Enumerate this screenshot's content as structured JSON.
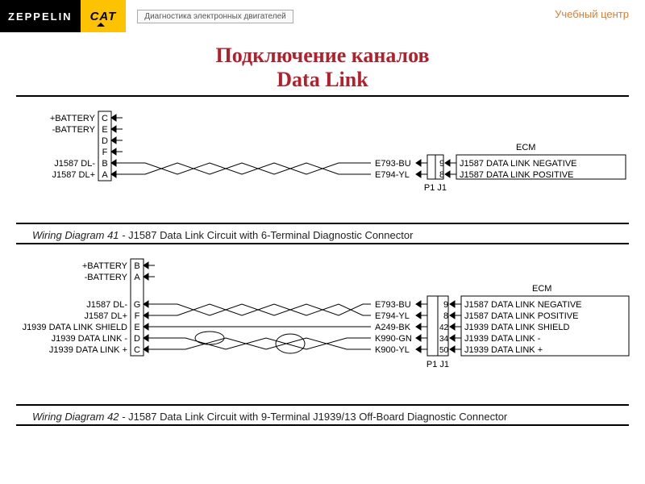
{
  "header": {
    "logo1": "ZEPPELIN",
    "logo2": "CAT",
    "subtitle": "Диагностика электронных двигателей",
    "right": "Учебный центр"
  },
  "title": {
    "line1": "Подключение каналов",
    "line2": "Data Link"
  },
  "d1": {
    "ecm_label": "ECM",
    "caption_prefix": "Wiring Diagram 41 - ",
    "caption": "J1587 Data Link Circuit with 6-Terminal Diagnostic Connector",
    "p1j1": "P1 J1",
    "left": {
      "bat_pos": "+BATTERY",
      "bat_neg": "-BATTERY",
      "j_dlm": "J1587 DL-",
      "j_dlp": "J1587 DL+"
    },
    "pins_left": {
      "c": "C",
      "e": "E",
      "d": "D",
      "f": "F",
      "b": "B",
      "a": "A"
    },
    "wires": {
      "bu": "E793-BU",
      "yl": "E794-YL"
    },
    "pins_right": {
      "p9": "9",
      "p8": "8"
    },
    "ecm": {
      "neg": "J1587 DATA LINK NEGATIVE",
      "pos": "J1587 DATA LINK POSITIVE"
    }
  },
  "d2": {
    "ecm_label": "ECM",
    "caption_prefix": "Wiring Diagram 42 - ",
    "caption": "J1587 Data Link Circuit with 9-Terminal J1939/13 Off-Board Diagnostic Connector",
    "p1j1": "P1 J1",
    "left": {
      "bat_pos": "+BATTERY",
      "bat_neg": "-BATTERY",
      "j_dlm": "J1587 DL-",
      "j_dlp": "J1587 DL+",
      "shield": "J1939 DATA LINK SHIELD",
      "j1939m": "J1939 DATA LINK -",
      "j1939p": "J1939 DATA LINK +"
    },
    "pins_left": {
      "b": "B",
      "a": "A",
      "g": "G",
      "f": "F",
      "e": "E",
      "d": "D",
      "c": "C"
    },
    "wires": {
      "bu": "E793-BU",
      "yl": "E794-YL",
      "bk": "A249-BK",
      "gn": "K990-GN",
      "yl2": "K900-YL"
    },
    "pins_right": {
      "p9": "9",
      "p8": "8",
      "p42": "42",
      "p34": "34",
      "p50": "50"
    },
    "ecm": {
      "neg": "J1587 DATA LINK NEGATIVE",
      "pos": "J1587 DATA LINK POSITIVE",
      "shield": "J1939 DATA LINK SHIELD",
      "j1939m": "J1939 DATA LINK -",
      "j1939p": "J1939 DATA LINK +"
    }
  }
}
